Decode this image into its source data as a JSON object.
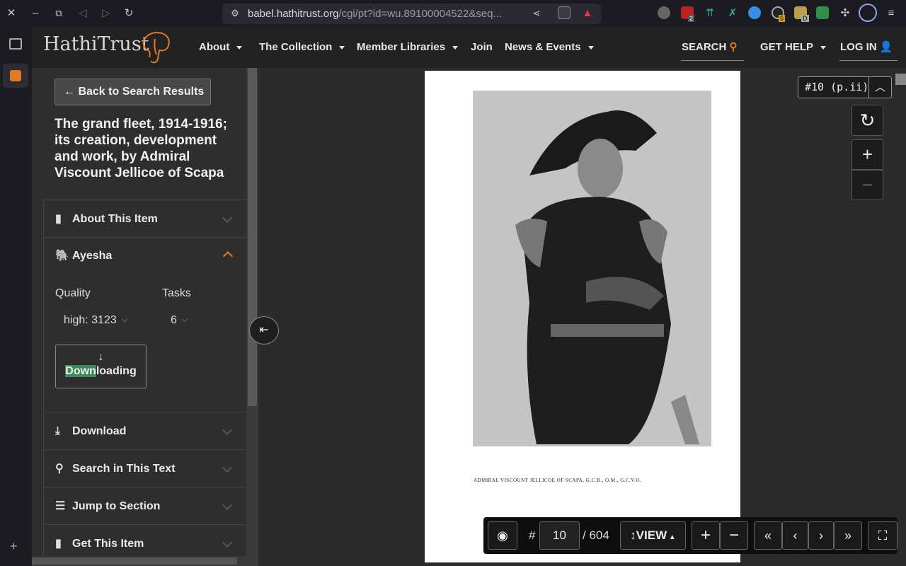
{
  "browser": {
    "url_domain": "babel.hathitrust.org",
    "url_rest": "/cgi/pt?id=wu.89100004522&seq...",
    "ext_badges": [
      "2",
      "5",
      "D"
    ]
  },
  "site": {
    "logo": "HathiTrust",
    "nav": [
      {
        "label": "About"
      },
      {
        "label": "The Collection"
      },
      {
        "label": "Member Libraries"
      },
      {
        "label": "Join"
      },
      {
        "label": "News & Events"
      }
    ],
    "search": "SEARCH",
    "help": "GET HELP",
    "login": "LOG IN"
  },
  "sidebar": {
    "back": "← Back to Search Results",
    "title": "The grand fleet, 1914-1916; its creation, development and work, by Admiral Viscount Jellicoe of Scapa",
    "about": "About This Item",
    "ayesha": "Ayesha",
    "quality_label": "Quality",
    "tasks_label": "Tasks",
    "quality_value": "high: 3123",
    "tasks_value": "6",
    "dl_arrow": "↓",
    "dl_hl": "Down",
    "dl_rest": "loading",
    "download": "Download",
    "search_text": "Search in This Text",
    "jump": "Jump to Section",
    "get": "Get This Item"
  },
  "viewer": {
    "caption": "ADMIRAL VISCOUNT JELLICOE OF SCAPA, G.C.B., O.M., G.C.V.O.",
    "page_tag": "#10 (p.ii)",
    "hash": "#",
    "page_num": "10",
    "total": "/ 604",
    "view": "VIEW"
  }
}
